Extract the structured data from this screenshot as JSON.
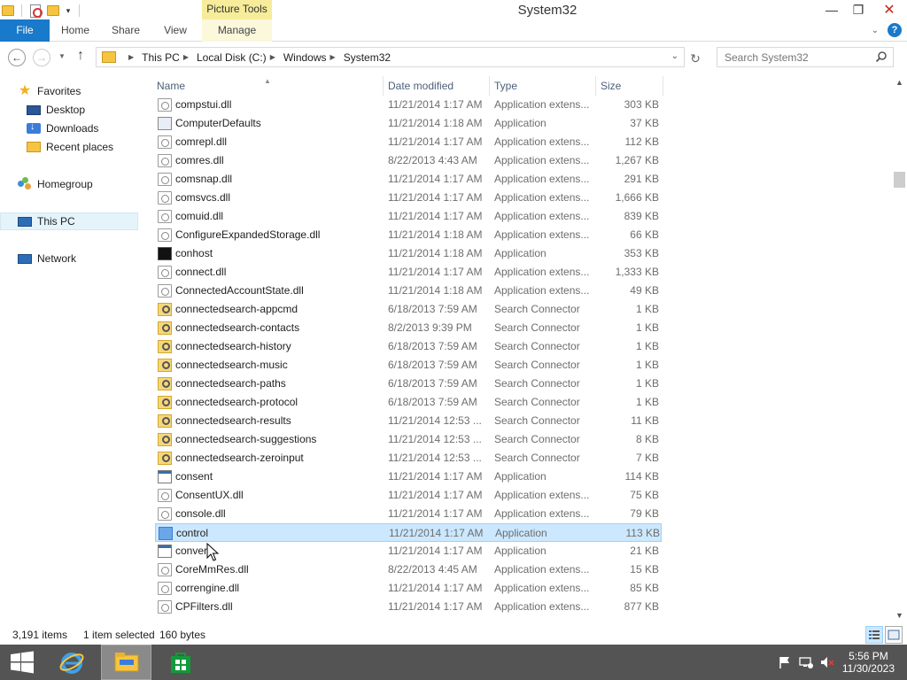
{
  "window": {
    "title": "System32",
    "context_tab_group": "Picture Tools",
    "minimize": "—",
    "maximize": "❐",
    "close": "✕"
  },
  "ribbon": {
    "tabs": [
      "File",
      "Home",
      "Share",
      "View",
      "Manage"
    ],
    "help": "?",
    "expand": "⌄"
  },
  "address": {
    "crumbs": [
      "This PC",
      "Local Disk (C:)",
      "Windows",
      "System32"
    ],
    "search_placeholder": "Search System32"
  },
  "navpane": {
    "favorites": "Favorites",
    "desktop": "Desktop",
    "downloads": "Downloads",
    "recent": "Recent places",
    "homegroup": "Homegroup",
    "this_pc": "This PC",
    "network": "Network"
  },
  "columns": {
    "name": "Name",
    "date": "Date modified",
    "type": "Type",
    "size": "Size"
  },
  "files": [
    {
      "name": "compstui.dll",
      "date": "11/21/2014 1:17 AM",
      "type": "Application extens...",
      "size": "303 KB",
      "icon": "dll"
    },
    {
      "name": "ComputerDefaults",
      "date": "11/21/2014 1:18 AM",
      "type": "Application",
      "size": "37 KB",
      "icon": "gear"
    },
    {
      "name": "comrepl.dll",
      "date": "11/21/2014 1:17 AM",
      "type": "Application extens...",
      "size": "112 KB",
      "icon": "dll"
    },
    {
      "name": "comres.dll",
      "date": "8/22/2013 4:43 AM",
      "type": "Application extens...",
      "size": "1,267 KB",
      "icon": "dll"
    },
    {
      "name": "comsnap.dll",
      "date": "11/21/2014 1:17 AM",
      "type": "Application extens...",
      "size": "291 KB",
      "icon": "dll"
    },
    {
      "name": "comsvcs.dll",
      "date": "11/21/2014 1:17 AM",
      "type": "Application extens...",
      "size": "1,666 KB",
      "icon": "dll"
    },
    {
      "name": "comuid.dll",
      "date": "11/21/2014 1:17 AM",
      "type": "Application extens...",
      "size": "839 KB",
      "icon": "dll"
    },
    {
      "name": "ConfigureExpandedStorage.dll",
      "date": "11/21/2014 1:18 AM",
      "type": "Application extens...",
      "size": "66 KB",
      "icon": "dll"
    },
    {
      "name": "conhost",
      "date": "11/21/2014 1:18 AM",
      "type": "Application",
      "size": "353 KB",
      "icon": "cmd"
    },
    {
      "name": "connect.dll",
      "date": "11/21/2014 1:17 AM",
      "type": "Application extens...",
      "size": "1,333 KB",
      "icon": "dll"
    },
    {
      "name": "ConnectedAccountState.dll",
      "date": "11/21/2014 1:18 AM",
      "type": "Application extens...",
      "size": "49 KB",
      "icon": "dll"
    },
    {
      "name": "connectedsearch-appcmd",
      "date": "6/18/2013 7:59 AM",
      "type": "Search Connector",
      "size": "1 KB",
      "icon": "search"
    },
    {
      "name": "connectedsearch-contacts",
      "date": "8/2/2013 9:39 PM",
      "type": "Search Connector",
      "size": "1 KB",
      "icon": "search"
    },
    {
      "name": "connectedsearch-history",
      "date": "6/18/2013 7:59 AM",
      "type": "Search Connector",
      "size": "1 KB",
      "icon": "search"
    },
    {
      "name": "connectedsearch-music",
      "date": "6/18/2013 7:59 AM",
      "type": "Search Connector",
      "size": "1 KB",
      "icon": "search"
    },
    {
      "name": "connectedsearch-paths",
      "date": "6/18/2013 7:59 AM",
      "type": "Search Connector",
      "size": "1 KB",
      "icon": "search"
    },
    {
      "name": "connectedsearch-protocol",
      "date": "6/18/2013 7:59 AM",
      "type": "Search Connector",
      "size": "1 KB",
      "icon": "search"
    },
    {
      "name": "connectedsearch-results",
      "date": "11/21/2014 12:53 ...",
      "type": "Search Connector",
      "size": "11 KB",
      "icon": "search"
    },
    {
      "name": "connectedsearch-suggestions",
      "date": "11/21/2014 12:53 ...",
      "type": "Search Connector",
      "size": "8 KB",
      "icon": "search"
    },
    {
      "name": "connectedsearch-zeroinput",
      "date": "11/21/2014 12:53 ...",
      "type": "Search Connector",
      "size": "7 KB",
      "icon": "search"
    },
    {
      "name": "consent",
      "date": "11/21/2014 1:17 AM",
      "type": "Application",
      "size": "114 KB",
      "icon": "app"
    },
    {
      "name": "ConsentUX.dll",
      "date": "11/21/2014 1:17 AM",
      "type": "Application extens...",
      "size": "75 KB",
      "icon": "dll"
    },
    {
      "name": "console.dll",
      "date": "11/21/2014 1:17 AM",
      "type": "Application extens...",
      "size": "79 KB",
      "icon": "dll"
    },
    {
      "name": "control",
      "date": "11/21/2014 1:17 AM",
      "type": "Application",
      "size": "113 KB",
      "icon": "control",
      "selected": true
    },
    {
      "name": "convert",
      "date": "11/21/2014 1:17 AM",
      "type": "Application",
      "size": "21 KB",
      "icon": "app"
    },
    {
      "name": "CoreMmRes.dll",
      "date": "8/22/2013 4:45 AM",
      "type": "Application extens...",
      "size": "15 KB",
      "icon": "dll"
    },
    {
      "name": "correngine.dll",
      "date": "11/21/2014 1:17 AM",
      "type": "Application extens...",
      "size": "85 KB",
      "icon": "dll"
    },
    {
      "name": "CPFilters.dll",
      "date": "11/21/2014 1:17 AM",
      "type": "Application extens...",
      "size": "877 KB",
      "icon": "dll"
    }
  ],
  "status": {
    "item_count": "3,191 items",
    "selection": "1 item selected",
    "selection_size": "160 bytes"
  },
  "taskbar": {
    "time": "5:56 PM",
    "date": "11/30/2023"
  },
  "colors": {
    "file_tab": "#1979ca",
    "selection_bg": "#cce8ff",
    "taskbar": "#545454",
    "picture_tools": "#f6ec9a"
  }
}
